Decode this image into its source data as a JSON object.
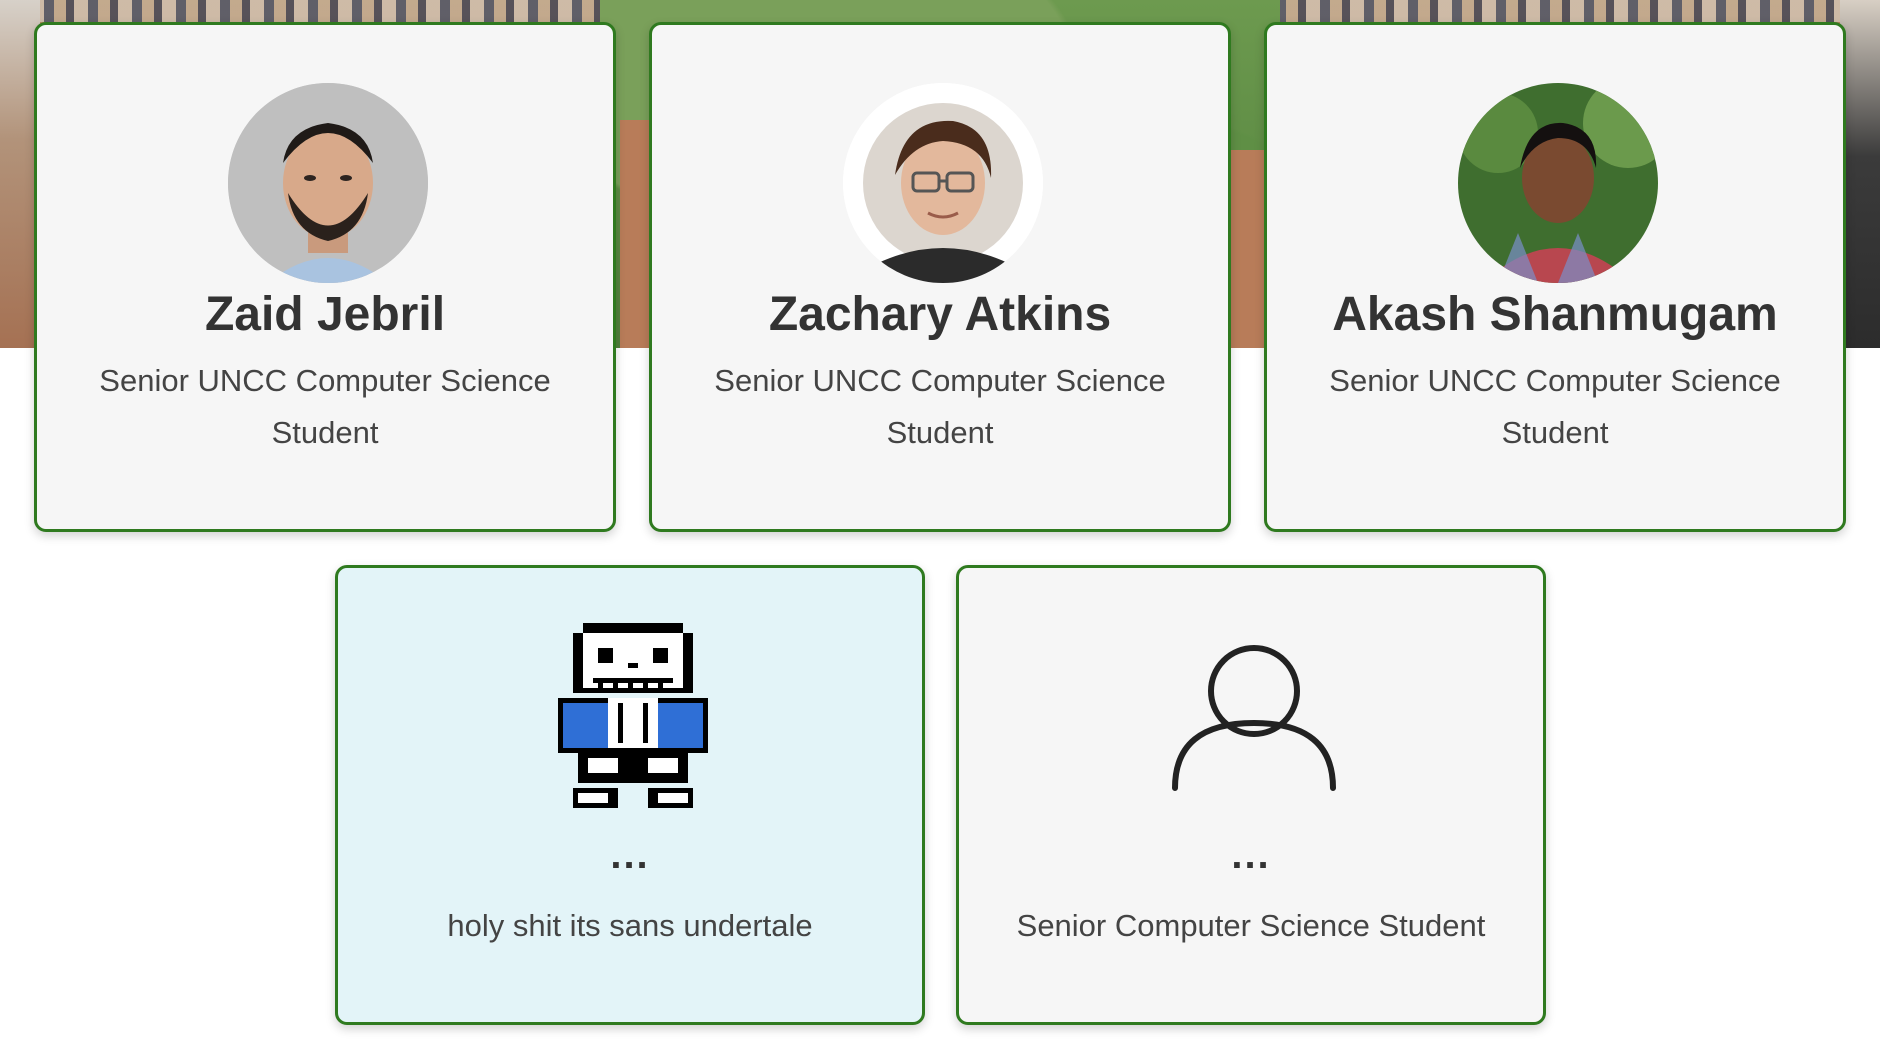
{
  "team": [
    {
      "name": "Zaid Jebril",
      "role": "Senior UNCC Computer Science Student",
      "avatar_icon": "person-photo"
    },
    {
      "name": "Zachary Atkins",
      "role": "Senior UNCC Computer Science Student",
      "avatar_icon": "person-photo"
    },
    {
      "name": "Akash Shanmugam",
      "role": "Senior UNCC Computer Science Student",
      "avatar_icon": "person-photo"
    },
    {
      "name": "...",
      "role": "holy shit its sans undertale",
      "avatar_icon": "pixel-skeleton-sprite"
    },
    {
      "name": "...",
      "role": "Senior Computer Science Student",
      "avatar_icon": "user-outline-icon"
    }
  ],
  "colors": {
    "card_border": "#2f7a1f",
    "card_background": "#f6f6f6",
    "highlight_card_background": "#e3f4f8"
  }
}
